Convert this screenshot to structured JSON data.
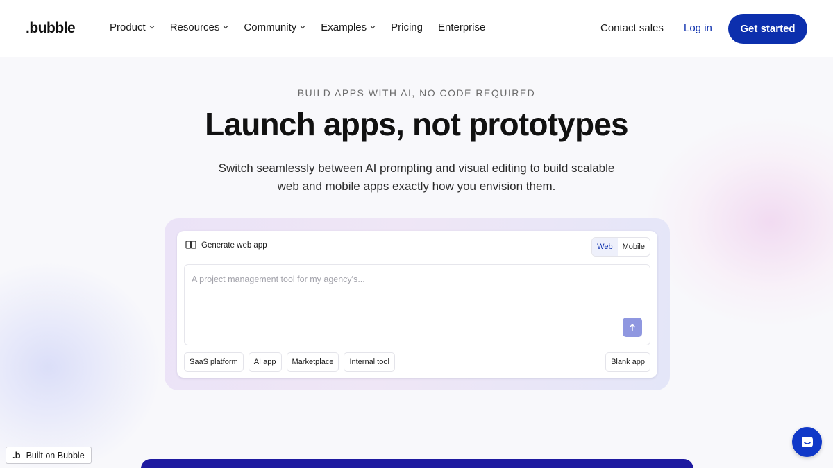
{
  "header": {
    "logo": ".bubble",
    "nav": [
      {
        "label": "Product",
        "dropdown": true
      },
      {
        "label": "Resources",
        "dropdown": true
      },
      {
        "label": "Community",
        "dropdown": true
      },
      {
        "label": "Examples",
        "dropdown": true
      },
      {
        "label": "Pricing",
        "dropdown": false
      },
      {
        "label": "Enterprise",
        "dropdown": false
      }
    ],
    "contact_label": "Contact sales",
    "login_label": "Log in",
    "cta_label": "Get started"
  },
  "hero": {
    "eyebrow": "BUILD APPS WITH AI, NO CODE REQUIRED",
    "headline": "Launch apps, not prototypes",
    "subhead": "Switch seamlessly between AI prompting and visual editing to build scalable web and mobile apps exactly how you envision them."
  },
  "generator": {
    "title": "Generate web app",
    "title_icon": "book-icon",
    "platform_options": [
      "Web",
      "Mobile"
    ],
    "selected_platform": "Web",
    "prompt_placeholder": "A project management tool for my agency's...",
    "send_icon": "arrow-up-icon",
    "suggestions": [
      "SaaS platform",
      "AI app",
      "Marketplace",
      "Internal tool"
    ],
    "blank_label": "Blank app"
  },
  "footer": {
    "built_on_icon": "bubble-b-icon",
    "built_on_label": "Built on Bubble",
    "chat_icon": "chat-icon"
  },
  "colors": {
    "brand": "#0c2fad",
    "send_button": "#8f97e0",
    "bottom_band": "#1e1aa0"
  }
}
